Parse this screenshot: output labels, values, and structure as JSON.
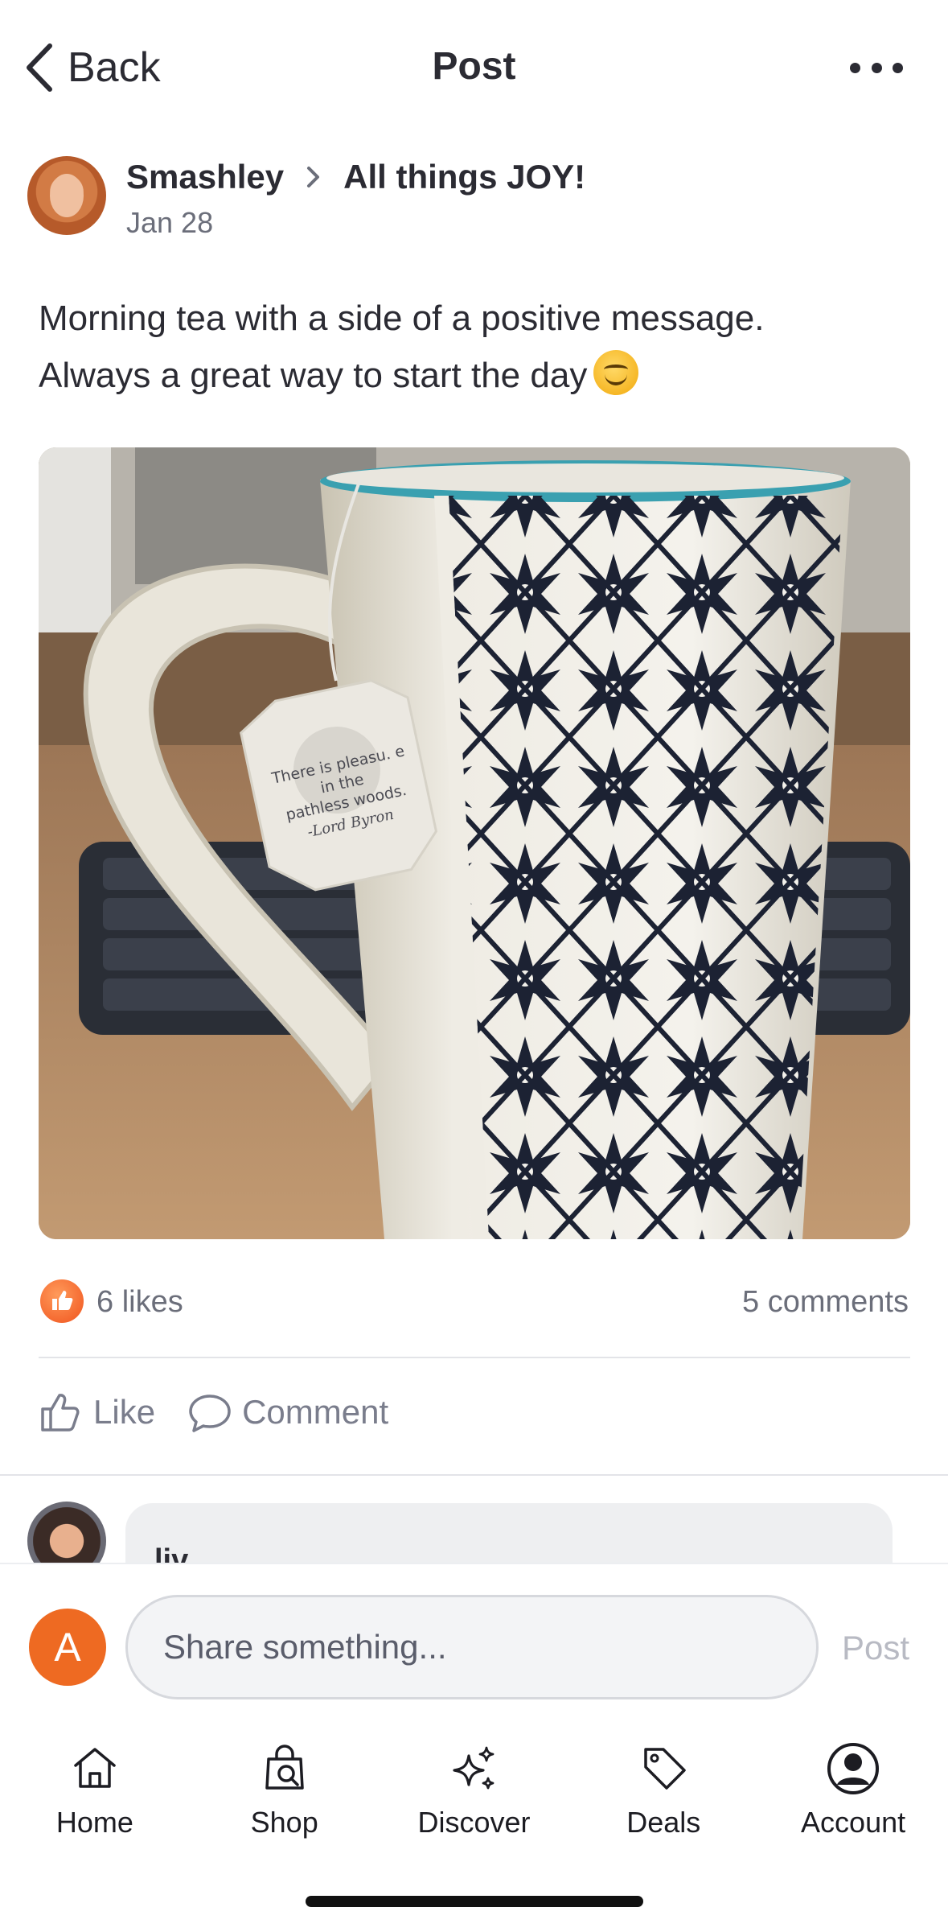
{
  "header": {
    "back_label": "Back",
    "title": "Post"
  },
  "post": {
    "author": "Smashley",
    "group": "All things JOY!",
    "date": "Jan 28",
    "text_line1": "Morning tea with a side of a positive message.",
    "text_line2": "Always a great way to start the day",
    "tea_tag": {
      "line1": "There is pleasu. e",
      "line2": "in the",
      "line3": "pathless woods.",
      "line4": "-Lord Byron"
    },
    "likes": "6 likes",
    "comments": "5 comments"
  },
  "actions": {
    "like_label": "Like",
    "comment_label": "Comment"
  },
  "comment_preview": {
    "author": "liv"
  },
  "composer": {
    "avatar_initial": "A",
    "placeholder": "Share something...",
    "post_label": "Post"
  },
  "tabbar": {
    "items": [
      {
        "label": "Home",
        "icon": "home-icon"
      },
      {
        "label": "Shop",
        "icon": "shop-icon"
      },
      {
        "label": "Discover",
        "icon": "sparkles-icon"
      },
      {
        "label": "Deals",
        "icon": "tag-icon"
      },
      {
        "label": "Account",
        "icon": "account-icon"
      }
    ]
  },
  "colors": {
    "accent": "#ee6a22",
    "text": "#2b2b33",
    "muted": "#6b6e7a"
  }
}
